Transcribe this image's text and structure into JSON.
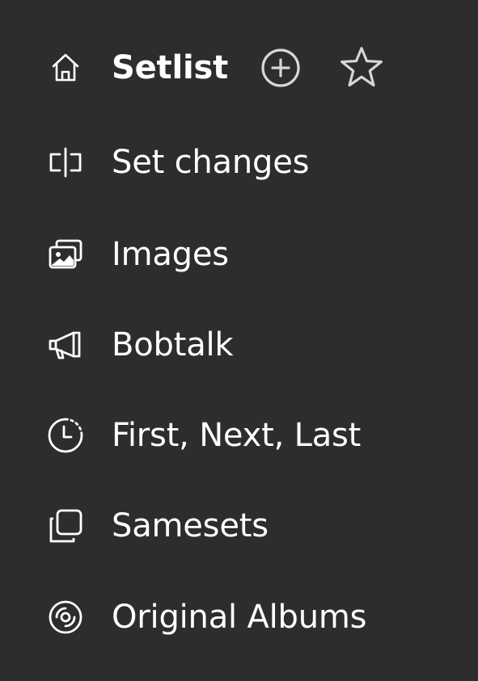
{
  "menu": {
    "items": [
      {
        "label": "Setlist",
        "icon": "home-icon"
      },
      {
        "label": "Set changes",
        "icon": "set-changes-icon"
      },
      {
        "label": "Images",
        "icon": "images-icon"
      },
      {
        "label": "Bobtalk",
        "icon": "megaphone-icon"
      },
      {
        "label": "First, Next, Last",
        "icon": "clock-icon"
      },
      {
        "label": "Samesets",
        "icon": "copy-icon"
      },
      {
        "label": "Original Albums",
        "icon": "disc-icon"
      }
    ],
    "actions": {
      "add_icon": "plus-circle-icon",
      "favorite_icon": "star-icon"
    }
  },
  "colors": {
    "background": "#2d2d2d",
    "foreground": "#ffffff",
    "action_icon": "#d7d7d7"
  }
}
